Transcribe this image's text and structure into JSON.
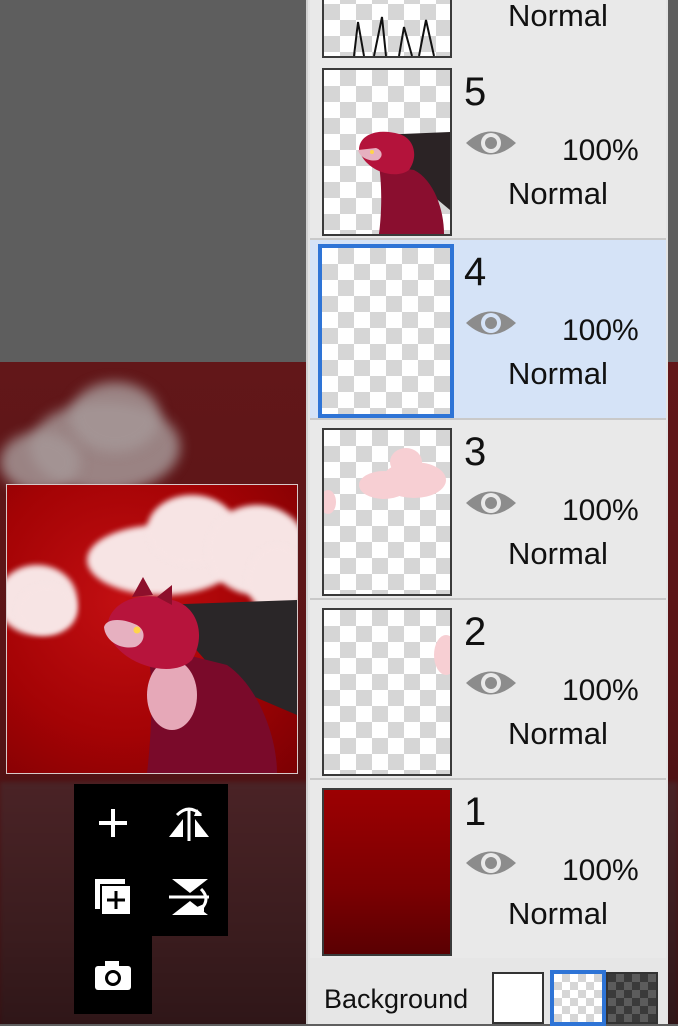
{
  "layers_panel": {
    "top_partial_layer": {
      "blend_mode": "Normal"
    },
    "layers": [
      {
        "number": "5",
        "opacity": "100%",
        "blend_mode": "Normal",
        "selected": false
      },
      {
        "number": "4",
        "opacity": "100%",
        "blend_mode": "Normal",
        "selected": true
      },
      {
        "number": "3",
        "opacity": "100%",
        "blend_mode": "Normal",
        "selected": false
      },
      {
        "number": "2",
        "opacity": "100%",
        "blend_mode": "Normal",
        "selected": false
      },
      {
        "number": "1",
        "opacity": "100%",
        "blend_mode": "Normal",
        "selected": false
      }
    ],
    "background": {
      "label": "Background",
      "options": [
        "white-swatch",
        "transparent-swatch",
        "dark-checker-swatch"
      ],
      "selected": "transparent-swatch"
    }
  },
  "toolbox": {
    "tools": [
      "add-layer-icon",
      "flip-horizontal-icon",
      "duplicate-layer-icon",
      "flip-vertical-icon",
      "camera-icon"
    ]
  },
  "colors": {
    "selection_accent": "#2e74d6",
    "selected_layer_bg": "#d5e3f7",
    "canvas_red": "#a40305"
  }
}
